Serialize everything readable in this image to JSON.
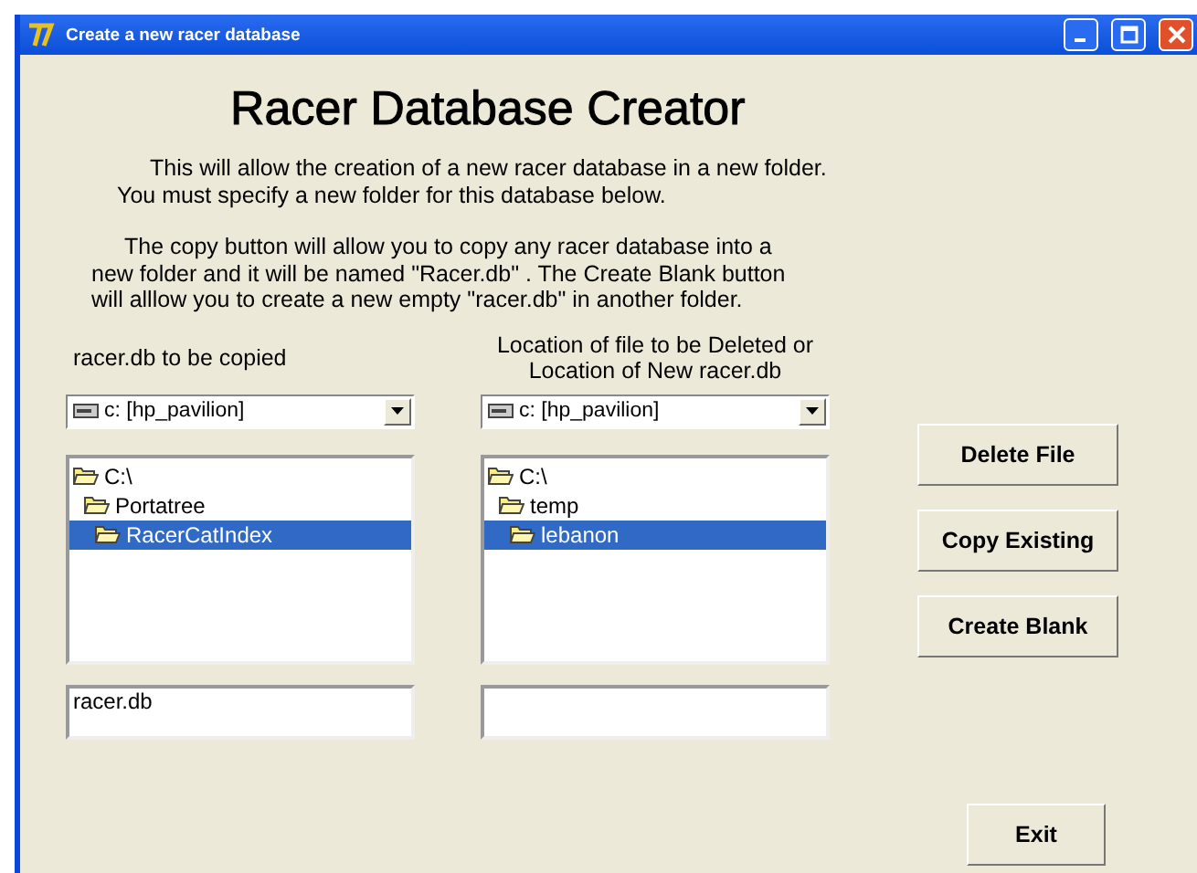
{
  "window": {
    "title": "Create a new racer database"
  },
  "heading": "Racer Database Creator",
  "paragraphs": [
    [
      "This will allow the creation of a new racer database in a new folder.",
      "You must specify a new folder for this database below."
    ],
    [
      "The copy button will allow you to copy any racer database into a",
      "new folder and it will be named \"Racer.db\" .  The Create Blank button",
      "will alllow you  to create a new empty \"racer.db\" in another folder."
    ]
  ],
  "panels": [
    {
      "label": [
        "racer.db to be copied"
      ],
      "drive": "c: [hp_pavilion]",
      "folders": [
        {
          "name": "C:\\",
          "selected": false,
          "children": [
            {
              "name": "Portatree",
              "selected": false,
              "children": [
                {
                  "name": "RacerCatIndex",
                  "selected": true
                }
              ]
            }
          ]
        }
      ],
      "file_field": {
        "value": "racer.db"
      }
    },
    {
      "label": [
        "Location of file to be Deleted or",
        "Location of New racer.db"
      ],
      "drive": "c: [hp_pavilion]",
      "folders": [
        {
          "name": "C:\\",
          "selected": false,
          "children": [
            {
              "name": "temp",
              "selected": false,
              "children": [
                {
                  "name": "lebanon",
                  "selected": true
                }
              ]
            }
          ]
        }
      ]
    }
  ],
  "buttons": [
    "Delete File",
    "Copy Existing",
    "Create Blank"
  ],
  "exit_button": "Exit"
}
